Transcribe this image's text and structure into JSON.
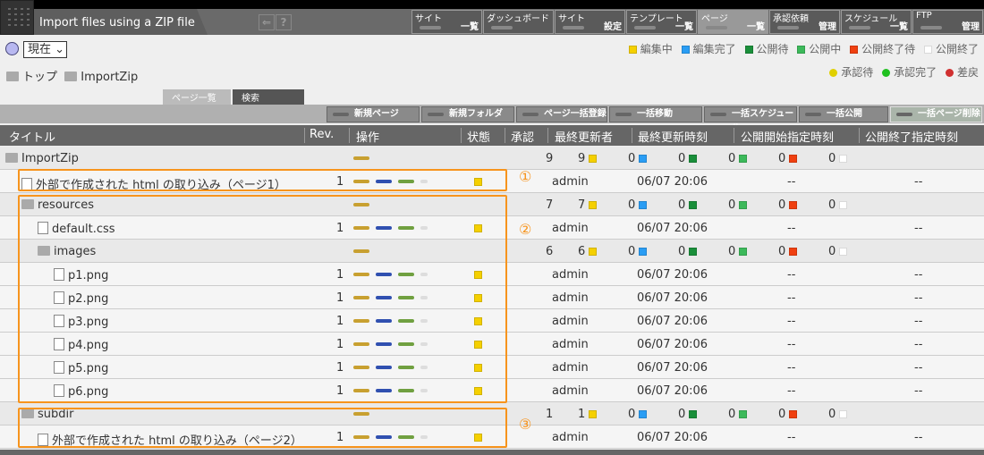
{
  "window": {
    "title": "Import files using a ZIP file",
    "back_icon": "back-icon",
    "help_icon": "?"
  },
  "nav": [
    {
      "top": "サイト",
      "bottom": "一覧"
    },
    {
      "top": "ダッシュボード",
      "bottom": ""
    },
    {
      "top": "サイト",
      "bottom": "設定"
    },
    {
      "top": "テンプレート",
      "bottom": "一覧"
    },
    {
      "top": "ページ",
      "bottom": "一覧",
      "active": true
    },
    {
      "top": "承認依頼",
      "bottom": "管理"
    },
    {
      "top": "スケジュール",
      "bottom": "一覧"
    },
    {
      "top": "FTP",
      "bottom": "管理"
    }
  ],
  "time_select": {
    "value": "現在"
  },
  "breadcrumb": [
    "トップ",
    "ImportZip"
  ],
  "status_legend": [
    {
      "label": "編集中",
      "color": "#f5d000"
    },
    {
      "label": "編集完了",
      "color": "#2a9df4"
    },
    {
      "label": "公開待",
      "color": "#1a8f3a"
    },
    {
      "label": "公開中",
      "color": "#3cb95a"
    },
    {
      "label": "公開終了待",
      "color": "#f04010"
    },
    {
      "label": "公開終了",
      "color": "#ffffff"
    }
  ],
  "approval_legend": [
    {
      "label": "承認待",
      "color": "#e0d000"
    },
    {
      "label": "承認完了",
      "color": "#20c020"
    },
    {
      "label": "差戻",
      "color": "#d03030"
    }
  ],
  "tabs": [
    "ページ一覧",
    "検索"
  ],
  "toolbar": [
    "新規ページ",
    "新規フォルダ",
    "ページ一括登録",
    "一括移動",
    "一括スケジュール",
    "一括公開",
    "一括ページ削除"
  ],
  "columns": [
    "タイトル",
    "Rev.",
    "操作",
    "状態",
    "承認",
    "最終更新者",
    "最終更新時刻",
    "公開開始指定時刻",
    "公開終了指定時刻"
  ],
  "rows": [
    {
      "type": "folder",
      "level": 0,
      "title": "ImportZip",
      "counts": [
        "9",
        "9",
        "0",
        "0",
        "0",
        "0",
        "0"
      ]
    },
    {
      "type": "file",
      "level": 1,
      "title": "外部で作成された html の取り込み（ページ1）",
      "rev": "1",
      "user": "admin",
      "time": "06/07 20:06",
      "start": "--",
      "end": "--"
    },
    {
      "type": "folder",
      "level": 1,
      "title": "resources",
      "counts": [
        "7",
        "7",
        "0",
        "0",
        "0",
        "0",
        "0"
      ]
    },
    {
      "type": "file",
      "level": 2,
      "title": "default.css",
      "rev": "1",
      "user": "admin",
      "time": "06/07 20:06",
      "start": "--",
      "end": "--"
    },
    {
      "type": "folder",
      "level": 2,
      "title": "images",
      "counts": [
        "6",
        "6",
        "0",
        "0",
        "0",
        "0",
        "0"
      ]
    },
    {
      "type": "file",
      "level": 3,
      "title": "p1.png",
      "rev": "1",
      "user": "admin",
      "time": "06/07 20:06",
      "start": "--",
      "end": "--"
    },
    {
      "type": "file",
      "level": 3,
      "title": "p2.png",
      "rev": "1",
      "user": "admin",
      "time": "06/07 20:06",
      "start": "--",
      "end": "--"
    },
    {
      "type": "file",
      "level": 3,
      "title": "p3.png",
      "rev": "1",
      "user": "admin",
      "time": "06/07 20:06",
      "start": "--",
      "end": "--"
    },
    {
      "type": "file",
      "level": 3,
      "title": "p4.png",
      "rev": "1",
      "user": "admin",
      "time": "06/07 20:06",
      "start": "--",
      "end": "--"
    },
    {
      "type": "file",
      "level": 3,
      "title": "p5.png",
      "rev": "1",
      "user": "admin",
      "time": "06/07 20:06",
      "start": "--",
      "end": "--"
    },
    {
      "type": "file",
      "level": 3,
      "title": "p6.png",
      "rev": "1",
      "user": "admin",
      "time": "06/07 20:06",
      "start": "--",
      "end": "--"
    },
    {
      "type": "folder",
      "level": 1,
      "title": "subdir",
      "counts": [
        "1",
        "1",
        "0",
        "0",
        "0",
        "0",
        "0"
      ]
    },
    {
      "type": "file",
      "level": 2,
      "title": "外部で作成された html の取り込み（ページ2）",
      "rev": "1",
      "user": "admin",
      "time": "06/07 20:06",
      "start": "--",
      "end": "--"
    }
  ],
  "annotations": [
    "①",
    "②",
    "③"
  ],
  "colors": {
    "highlight": "#f7941d",
    "header": "#666666"
  }
}
